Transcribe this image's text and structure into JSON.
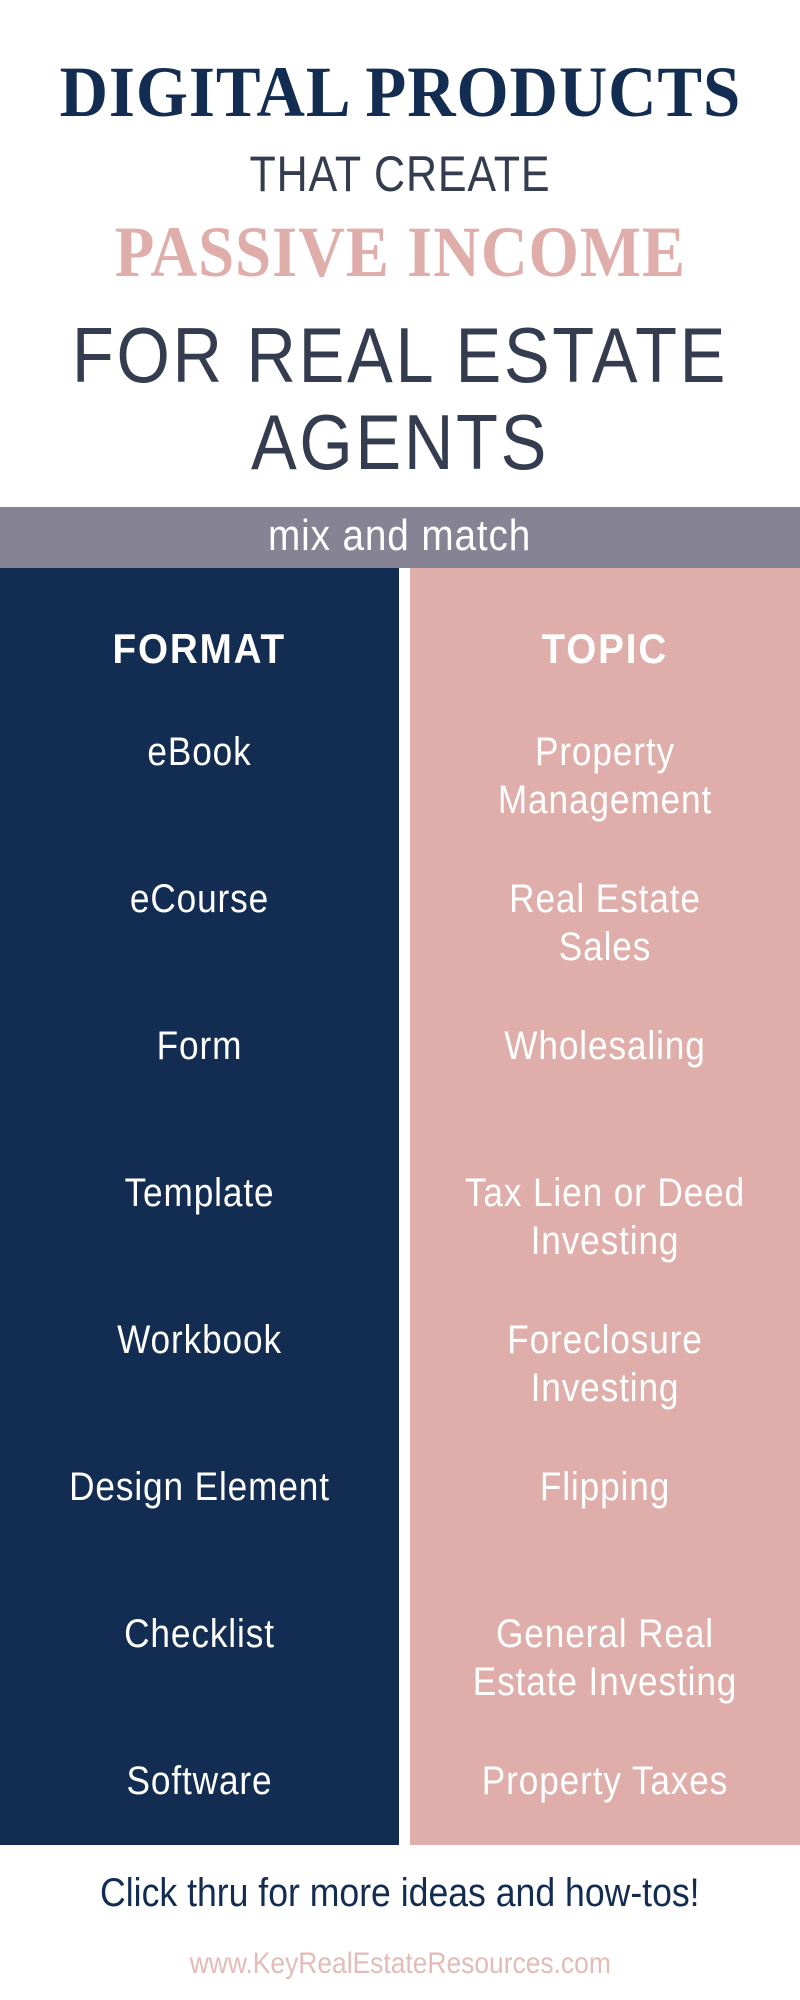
{
  "header": {
    "line1": "DIGITAL PRODUCTS",
    "line2": "THAT CREATE",
    "line3": "PASSIVE INCOME",
    "line4": [
      "FOR REAL ESTATE",
      "AGENTS"
    ]
  },
  "band": {
    "label": "mix and match"
  },
  "columns": {
    "format": {
      "heading": "FORMAT",
      "items": [
        [
          "eBook"
        ],
        [
          "eCourse"
        ],
        [
          "Form"
        ],
        [
          "Template"
        ],
        [
          "Workbook"
        ],
        [
          "Design Element"
        ],
        [
          "Checklist"
        ],
        [
          "Software"
        ]
      ]
    },
    "topic": {
      "heading": "TOPIC",
      "items": [
        [
          "Property",
          "Management"
        ],
        [
          "Real Estate",
          "Sales"
        ],
        [
          "Wholesaling"
        ],
        [
          "Tax Lien or Deed",
          "Investing"
        ],
        [
          "Foreclosure",
          "Investing"
        ],
        [
          "Flipping"
        ],
        [
          "General Real",
          "Estate Investing"
        ],
        [
          "Property Taxes"
        ]
      ]
    }
  },
  "footer": {
    "cta": "Click thru for more ideas and how-tos!",
    "url": "www.KeyRealEstateResources.com"
  },
  "colors": {
    "navy": "#132c51",
    "pink": "#e0aeaa",
    "band_gray": "#858394",
    "title_dark": "#363c4f"
  }
}
